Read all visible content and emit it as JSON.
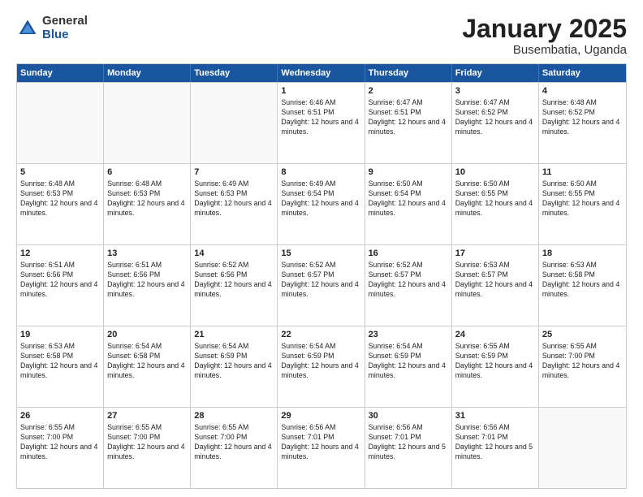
{
  "header": {
    "logo_general": "General",
    "logo_blue": "Blue",
    "title": "January 2025",
    "subtitle": "Busembatia, Uganda"
  },
  "days_of_week": [
    "Sunday",
    "Monday",
    "Tuesday",
    "Wednesday",
    "Thursday",
    "Friday",
    "Saturday"
  ],
  "weeks": [
    [
      {
        "day": "",
        "empty": true
      },
      {
        "day": "",
        "empty": true
      },
      {
        "day": "",
        "empty": true
      },
      {
        "day": "1",
        "sunrise": "6:46 AM",
        "sunset": "6:51 PM",
        "daylight": "12 hours and 4 minutes."
      },
      {
        "day": "2",
        "sunrise": "6:47 AM",
        "sunset": "6:51 PM",
        "daylight": "12 hours and 4 minutes."
      },
      {
        "day": "3",
        "sunrise": "6:47 AM",
        "sunset": "6:52 PM",
        "daylight": "12 hours and 4 minutes."
      },
      {
        "day": "4",
        "sunrise": "6:48 AM",
        "sunset": "6:52 PM",
        "daylight": "12 hours and 4 minutes."
      }
    ],
    [
      {
        "day": "5",
        "sunrise": "6:48 AM",
        "sunset": "6:53 PM",
        "daylight": "12 hours and 4 minutes."
      },
      {
        "day": "6",
        "sunrise": "6:48 AM",
        "sunset": "6:53 PM",
        "daylight": "12 hours and 4 minutes."
      },
      {
        "day": "7",
        "sunrise": "6:49 AM",
        "sunset": "6:53 PM",
        "daylight": "12 hours and 4 minutes."
      },
      {
        "day": "8",
        "sunrise": "6:49 AM",
        "sunset": "6:54 PM",
        "daylight": "12 hours and 4 minutes."
      },
      {
        "day": "9",
        "sunrise": "6:50 AM",
        "sunset": "6:54 PM",
        "daylight": "12 hours and 4 minutes."
      },
      {
        "day": "10",
        "sunrise": "6:50 AM",
        "sunset": "6:55 PM",
        "daylight": "12 hours and 4 minutes."
      },
      {
        "day": "11",
        "sunrise": "6:50 AM",
        "sunset": "6:55 PM",
        "daylight": "12 hours and 4 minutes."
      }
    ],
    [
      {
        "day": "12",
        "sunrise": "6:51 AM",
        "sunset": "6:56 PM",
        "daylight": "12 hours and 4 minutes."
      },
      {
        "day": "13",
        "sunrise": "6:51 AM",
        "sunset": "6:56 PM",
        "daylight": "12 hours and 4 minutes."
      },
      {
        "day": "14",
        "sunrise": "6:52 AM",
        "sunset": "6:56 PM",
        "daylight": "12 hours and 4 minutes."
      },
      {
        "day": "15",
        "sunrise": "6:52 AM",
        "sunset": "6:57 PM",
        "daylight": "12 hours and 4 minutes."
      },
      {
        "day": "16",
        "sunrise": "6:52 AM",
        "sunset": "6:57 PM",
        "daylight": "12 hours and 4 minutes."
      },
      {
        "day": "17",
        "sunrise": "6:53 AM",
        "sunset": "6:57 PM",
        "daylight": "12 hours and 4 minutes."
      },
      {
        "day": "18",
        "sunrise": "6:53 AM",
        "sunset": "6:58 PM",
        "daylight": "12 hours and 4 minutes."
      }
    ],
    [
      {
        "day": "19",
        "sunrise": "6:53 AM",
        "sunset": "6:58 PM",
        "daylight": "12 hours and 4 minutes."
      },
      {
        "day": "20",
        "sunrise": "6:54 AM",
        "sunset": "6:58 PM",
        "daylight": "12 hours and 4 minutes."
      },
      {
        "day": "21",
        "sunrise": "6:54 AM",
        "sunset": "6:59 PM",
        "daylight": "12 hours and 4 minutes."
      },
      {
        "day": "22",
        "sunrise": "6:54 AM",
        "sunset": "6:59 PM",
        "daylight": "12 hours and 4 minutes."
      },
      {
        "day": "23",
        "sunrise": "6:54 AM",
        "sunset": "6:59 PM",
        "daylight": "12 hours and 4 minutes."
      },
      {
        "day": "24",
        "sunrise": "6:55 AM",
        "sunset": "6:59 PM",
        "daylight": "12 hours and 4 minutes."
      },
      {
        "day": "25",
        "sunrise": "6:55 AM",
        "sunset": "7:00 PM",
        "daylight": "12 hours and 4 minutes."
      }
    ],
    [
      {
        "day": "26",
        "sunrise": "6:55 AM",
        "sunset": "7:00 PM",
        "daylight": "12 hours and 4 minutes."
      },
      {
        "day": "27",
        "sunrise": "6:55 AM",
        "sunset": "7:00 PM",
        "daylight": "12 hours and 4 minutes."
      },
      {
        "day": "28",
        "sunrise": "6:55 AM",
        "sunset": "7:00 PM",
        "daylight": "12 hours and 4 minutes."
      },
      {
        "day": "29",
        "sunrise": "6:56 AM",
        "sunset": "7:01 PM",
        "daylight": "12 hours and 4 minutes."
      },
      {
        "day": "30",
        "sunrise": "6:56 AM",
        "sunset": "7:01 PM",
        "daylight": "12 hours and 5 minutes."
      },
      {
        "day": "31",
        "sunrise": "6:56 AM",
        "sunset": "7:01 PM",
        "daylight": "12 hours and 5 minutes."
      },
      {
        "day": "",
        "empty": true
      }
    ]
  ],
  "labels": {
    "sunrise_prefix": "Sunrise: ",
    "sunset_prefix": "Sunset: ",
    "daylight_prefix": "Daylight: "
  }
}
